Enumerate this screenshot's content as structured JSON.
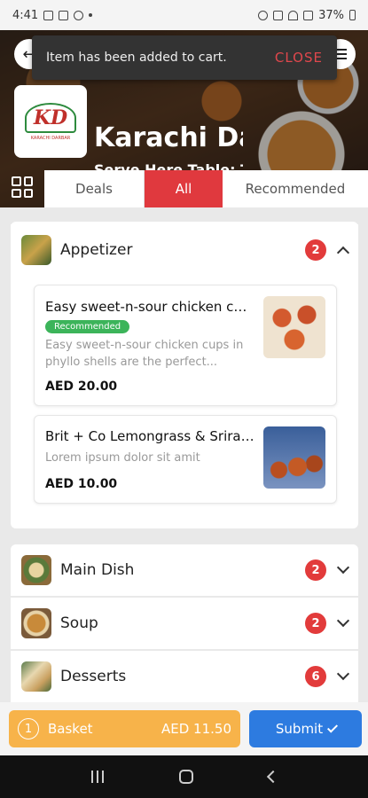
{
  "status_bar": {
    "time": "4:41",
    "battery": "37%"
  },
  "toast": {
    "message": "Item has been added to cart.",
    "action": "CLOSE"
  },
  "restaurant": {
    "name": "Karachi Darbar",
    "table": "Serve Here Table: To",
    "logo_text": "KD",
    "logo_sub": "KARACHI DARBAR"
  },
  "tabs": [
    {
      "label": "Deals"
    },
    {
      "label": "All"
    },
    {
      "label": "Recommended"
    }
  ],
  "categories": [
    {
      "name": "Appetizer",
      "count": "2",
      "expanded": true
    },
    {
      "name": "Main Dish",
      "count": "2"
    },
    {
      "name": "Soup",
      "count": "2"
    },
    {
      "name": "Desserts",
      "count": "6"
    }
  ],
  "appetizer_items": [
    {
      "title": "Easy sweet-n-sour chicken cups",
      "badge": "Recommended",
      "description": "Easy sweet-n-sour chicken cups in phyllo shells are the perfect...",
      "price": "AED 20.00"
    },
    {
      "title": "Brit + Co Lemongrass & Sriracha",
      "description": "Lorem ipsum dolor sit amit",
      "price": "AED 10.00"
    }
  ],
  "basket": {
    "count": "1",
    "label": "Basket",
    "total": "AED 11.50"
  },
  "submit_label": "Submit",
  "colors": {
    "accent_red": "#e0393e",
    "basket_orange": "#f7b34a",
    "submit_blue": "#2d7be0",
    "recommended_green": "#3cb45a"
  }
}
